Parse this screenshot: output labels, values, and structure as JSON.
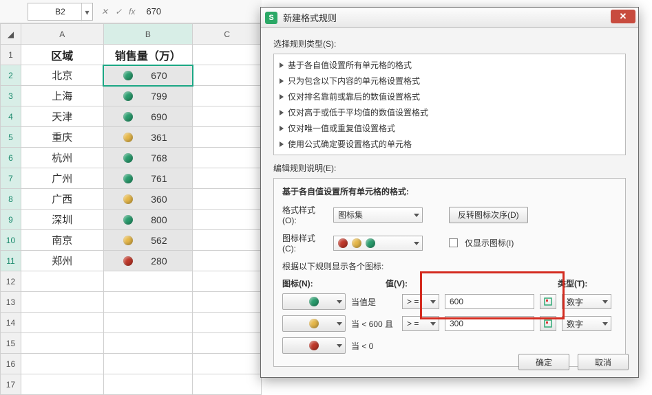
{
  "namebox": "B2",
  "formula_value": "670",
  "columns": [
    "A",
    "B",
    "C"
  ],
  "headers": {
    "A": "区域",
    "B": "销售量（万）"
  },
  "rows": [
    {
      "n": 1
    },
    {
      "n": 2,
      "region": "北京",
      "val": "670",
      "dot": "green"
    },
    {
      "n": 3,
      "region": "上海",
      "val": "799",
      "dot": "green"
    },
    {
      "n": 4,
      "region": "天津",
      "val": "690",
      "dot": "green"
    },
    {
      "n": 5,
      "region": "重庆",
      "val": "361",
      "dot": "yellow"
    },
    {
      "n": 6,
      "region": "杭州",
      "val": "768",
      "dot": "green"
    },
    {
      "n": 7,
      "region": "广州",
      "val": "761",
      "dot": "green"
    },
    {
      "n": 8,
      "region": "广西",
      "val": "360",
      "dot": "yellow"
    },
    {
      "n": 9,
      "region": "深圳",
      "val": "800",
      "dot": "green"
    },
    {
      "n": 10,
      "region": "南京",
      "val": "562",
      "dot": "yellow"
    },
    {
      "n": 11,
      "region": "郑州",
      "val": "280",
      "dot": "red"
    },
    {
      "n": 12
    },
    {
      "n": 13
    },
    {
      "n": 14
    },
    {
      "n": 15
    },
    {
      "n": 16
    },
    {
      "n": 17
    }
  ],
  "dialog": {
    "title": "新建格式规则",
    "section_type": "选择规则类型(S):",
    "rule_types": [
      "基于各自值设置所有单元格的格式",
      "只为包含以下内容的单元格设置格式",
      "仅对排名靠前或靠后的数值设置格式",
      "仅对高于或低于平均值的数值设置格式",
      "仅对唯一值或重复值设置格式",
      "使用公式确定要设置格式的单元格"
    ],
    "section_edit": "编辑规则说明(E):",
    "panel_head": "基于各自值设置所有单元格的格式:",
    "fmt_style_lbl": "格式样式(O):",
    "fmt_style_val": "图标集",
    "reverse_btn": "反转图标次序(D)",
    "icon_style_lbl": "图标样式(C):",
    "only_icon_lbl": "仅显示图标(I)",
    "rule_desc": "根据以下规则显示各个图标:",
    "hdr_icon": "图标(N):",
    "hdr_value": "值(V):",
    "hdr_type": "类型(T):",
    "rows": [
      {
        "dot": "green",
        "cond": "当值是",
        "op": "> =",
        "val": "600",
        "type": "数字",
        "framed": true
      },
      {
        "dot": "yellow",
        "cond": "当 < 600 且",
        "op": "> =",
        "val": "300",
        "type": "数字",
        "framed": true
      },
      {
        "dot": "red",
        "cond": "当 < 0"
      }
    ],
    "ok": "确定",
    "cancel": "取消"
  }
}
